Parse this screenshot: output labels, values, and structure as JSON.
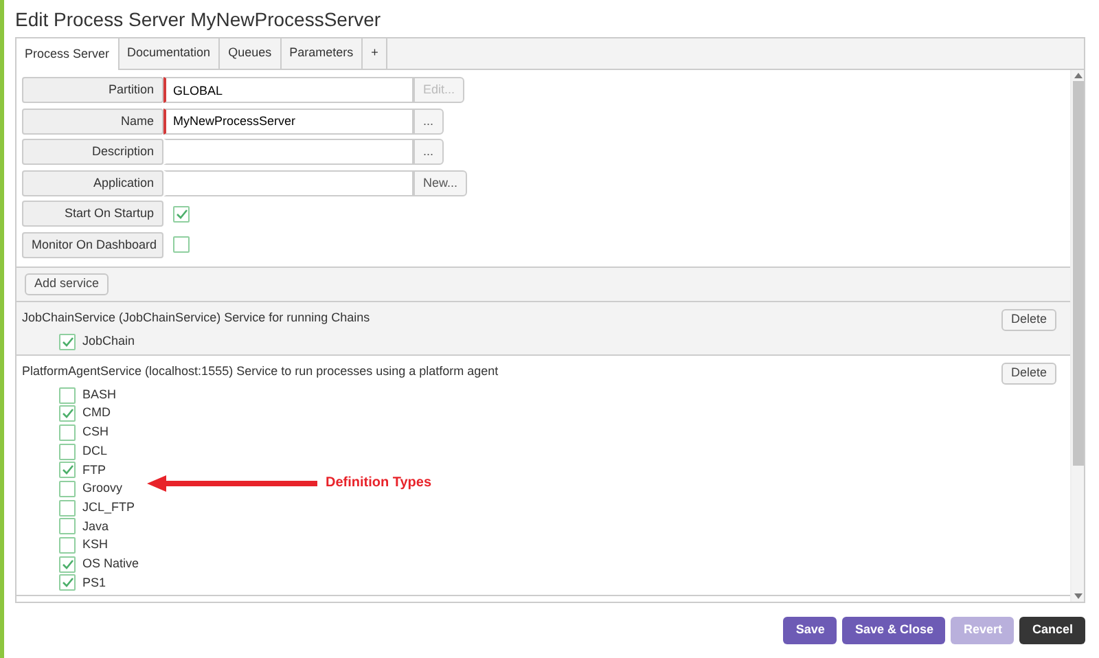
{
  "window": {
    "title": "Edit Process Server MyNewProcessServer"
  },
  "tabs": [
    {
      "label": "Process Server",
      "selected": true
    },
    {
      "label": "Documentation",
      "selected": false
    },
    {
      "label": "Queues",
      "selected": false
    },
    {
      "label": "Parameters",
      "selected": false
    },
    {
      "label": "+",
      "selected": false
    }
  ],
  "fields": [
    {
      "kind": "text",
      "label": "Partition",
      "value": "GLOBAL",
      "required": true,
      "button": {
        "label": "Edit...",
        "disabled": true
      }
    },
    {
      "kind": "text",
      "label": "Name",
      "value": "MyNewProcessServer",
      "required": true,
      "button": {
        "label": "...",
        "disabled": false
      }
    },
    {
      "kind": "text",
      "label": "Description",
      "required": false,
      "button": {
        "label": "...",
        "disabled": false
      }
    },
    {
      "kind": "text",
      "label": "Application",
      "required": false,
      "button": {
        "label": "New...",
        "disabled": false
      }
    },
    {
      "kind": "checkbox",
      "label": "Start On Startup",
      "checked": true
    },
    {
      "kind": "checkbox",
      "label": "Monitor On Dashboard",
      "checked": false
    }
  ],
  "add_service_button": "Add service",
  "services": [
    {
      "description": "JobChainService (JobChainService) Service for running Chains",
      "delete_button": "Delete",
      "shaded": true,
      "types": [
        {
          "label": "JobChain",
          "checked": true
        }
      ]
    },
    {
      "description": "PlatformAgentService (localhost:1555) Service to run processes using a platform agent",
      "delete_button": "Delete",
      "shaded": false,
      "types": [
        {
          "label": "BASH",
          "checked": false
        },
        {
          "label": "CMD",
          "checked": true
        },
        {
          "label": "CSH",
          "checked": false
        },
        {
          "label": "DCL",
          "checked": false
        },
        {
          "label": "FTP",
          "checked": true
        },
        {
          "label": "Groovy",
          "checked": false
        },
        {
          "label": "JCL_FTP",
          "checked": false
        },
        {
          "label": "Java",
          "checked": false
        },
        {
          "label": "KSH",
          "checked": false
        },
        {
          "label": "OS Native",
          "checked": true
        },
        {
          "label": "PS1",
          "checked": true
        }
      ]
    }
  ],
  "annotation": {
    "text": "Definition Types"
  },
  "buttons": [
    {
      "label": "Save",
      "kind": "primary",
      "disabled": false
    },
    {
      "label": "Save & Close",
      "kind": "primary",
      "disabled": false
    },
    {
      "label": "Revert",
      "kind": "primary",
      "disabled": true
    },
    {
      "label": "Cancel",
      "kind": "dark",
      "disabled": false
    }
  ]
}
